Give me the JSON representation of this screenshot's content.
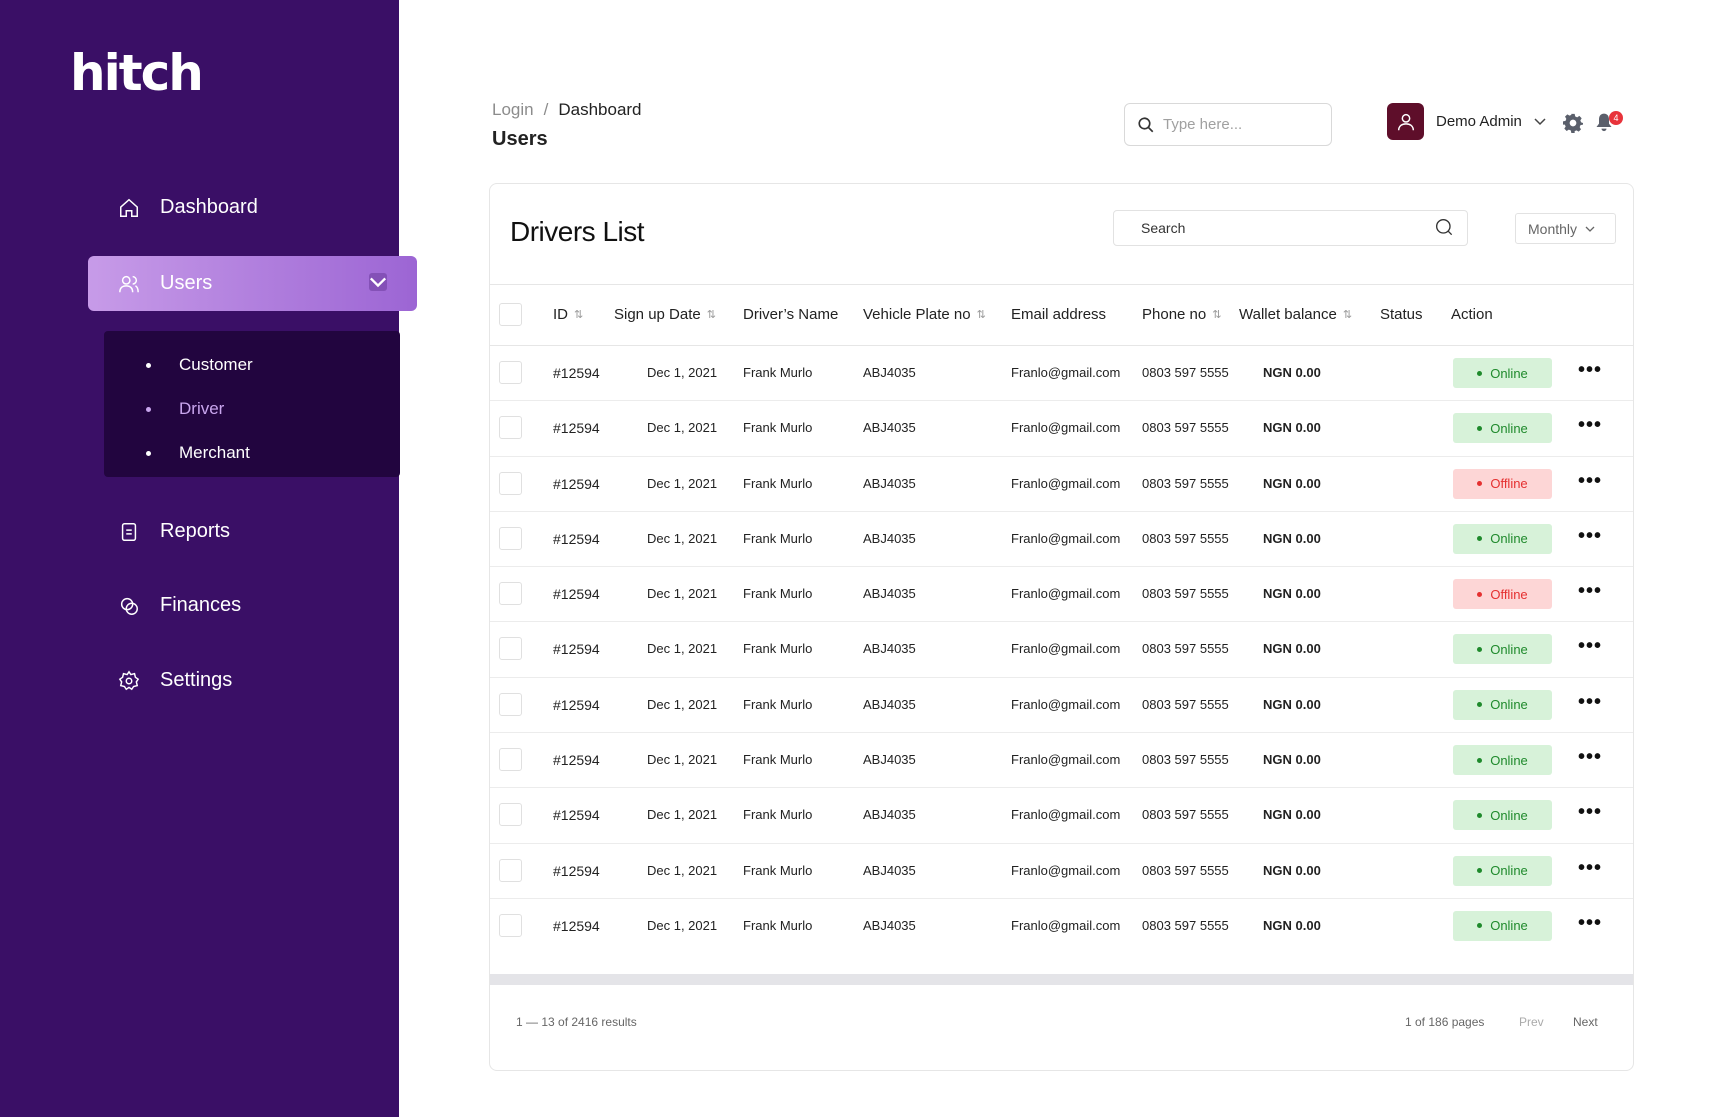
{
  "sidebar": {
    "logo": "hitch",
    "nav": {
      "dashboard": "Dashboard",
      "users": "Users",
      "reports": "Reports",
      "finances": "Finances",
      "settings": "Settings"
    },
    "users_sub": [
      "Customer",
      "Driver",
      "Merchant"
    ],
    "active_sub": "Driver"
  },
  "header": {
    "breadcrumb_parent": "Login",
    "breadcrumb_sep": "/",
    "breadcrumb_current": "Dashboard",
    "page_title": "Users",
    "search_placeholder": "Type here...",
    "user_name": "Demo Admin",
    "notification_count": "4"
  },
  "card": {
    "title": "Drivers List",
    "search_placeholder": "Search",
    "period": "Monthly",
    "columns": {
      "id": "ID",
      "signup": "Sign up Date",
      "name": "Driver’s Name",
      "plate": "Vehicle Plate no",
      "email": "Email address",
      "phone": "Phone no",
      "wallet": "Wallet balance",
      "status": "Status",
      "action": "Action"
    },
    "rows": [
      {
        "id": "#12594",
        "signup": "Dec 1, 2021",
        "name": "Frank Murlo",
        "plate": "ABJ4035",
        "email": "Franlo@gmail.com",
        "phone": "0803 597 5555",
        "wallet": "NGN 0.00",
        "status": "Online"
      },
      {
        "id": "#12594",
        "signup": "Dec 1, 2021",
        "name": "Frank Murlo",
        "plate": "ABJ4035",
        "email": "Franlo@gmail.com",
        "phone": "0803 597 5555",
        "wallet": "NGN 0.00",
        "status": "Online"
      },
      {
        "id": "#12594",
        "signup": "Dec 1, 2021",
        "name": "Frank Murlo",
        "plate": "ABJ4035",
        "email": "Franlo@gmail.com",
        "phone": "0803 597 5555",
        "wallet": "NGN 0.00",
        "status": "Offline"
      },
      {
        "id": "#12594",
        "signup": "Dec 1, 2021",
        "name": "Frank Murlo",
        "plate": "ABJ4035",
        "email": "Franlo@gmail.com",
        "phone": "0803 597 5555",
        "wallet": "NGN 0.00",
        "status": "Online"
      },
      {
        "id": "#12594",
        "signup": "Dec 1, 2021",
        "name": "Frank Murlo",
        "plate": "ABJ4035",
        "email": "Franlo@gmail.com",
        "phone": "0803 597 5555",
        "wallet": "NGN 0.00",
        "status": "Offline"
      },
      {
        "id": "#12594",
        "signup": "Dec 1, 2021",
        "name": "Frank Murlo",
        "plate": "ABJ4035",
        "email": "Franlo@gmail.com",
        "phone": "0803 597 5555",
        "wallet": "NGN 0.00",
        "status": "Online"
      },
      {
        "id": "#12594",
        "signup": "Dec 1, 2021",
        "name": "Frank Murlo",
        "plate": "ABJ4035",
        "email": "Franlo@gmail.com",
        "phone": "0803 597 5555",
        "wallet": "NGN 0.00",
        "status": "Online"
      },
      {
        "id": "#12594",
        "signup": "Dec 1, 2021",
        "name": "Frank Murlo",
        "plate": "ABJ4035",
        "email": "Franlo@gmail.com",
        "phone": "0803 597 5555",
        "wallet": "NGN 0.00",
        "status": "Online"
      },
      {
        "id": "#12594",
        "signup": "Dec 1, 2021",
        "name": "Frank Murlo",
        "plate": "ABJ4035",
        "email": "Franlo@gmail.com",
        "phone": "0803 597 5555",
        "wallet": "NGN 0.00",
        "status": "Online"
      },
      {
        "id": "#12594",
        "signup": "Dec 1, 2021",
        "name": "Frank Murlo",
        "plate": "ABJ4035",
        "email": "Franlo@gmail.com",
        "phone": "0803 597 5555",
        "wallet": "NGN 0.00",
        "status": "Online"
      },
      {
        "id": "#12594",
        "signup": "Dec 1, 2021",
        "name": "Frank Murlo",
        "plate": "ABJ4035",
        "email": "Franlo@gmail.com",
        "phone": "0803 597 5555",
        "wallet": "NGN 0.00",
        "status": "Online"
      }
    ],
    "action_glyph": "•••",
    "footer": {
      "results": "1 — 13 of 2416 results",
      "pages": "1 of 186 pages",
      "prev": "Prev",
      "next": "Next"
    }
  },
  "colors": {
    "sidebar_bg": "#3a0f66",
    "subnav_bg": "#22053f",
    "active_gradient_start": "#c79be8",
    "active_gradient_end": "#9c65d4",
    "online_bg": "#d7f2d9",
    "online_text": "#1f8a2c",
    "offline_bg": "#fdd6d6",
    "offline_text": "#e53030",
    "avatar_bg": "#5e0e2a",
    "badge": "#e8333b"
  },
  "icons": {
    "dashboard": "home-icon",
    "users": "users-icon",
    "reports": "document-icon",
    "finances": "coins-icon",
    "settings": "gear-icon",
    "search": "search-icon",
    "bell": "bell-icon",
    "sort": "sort-icon"
  }
}
